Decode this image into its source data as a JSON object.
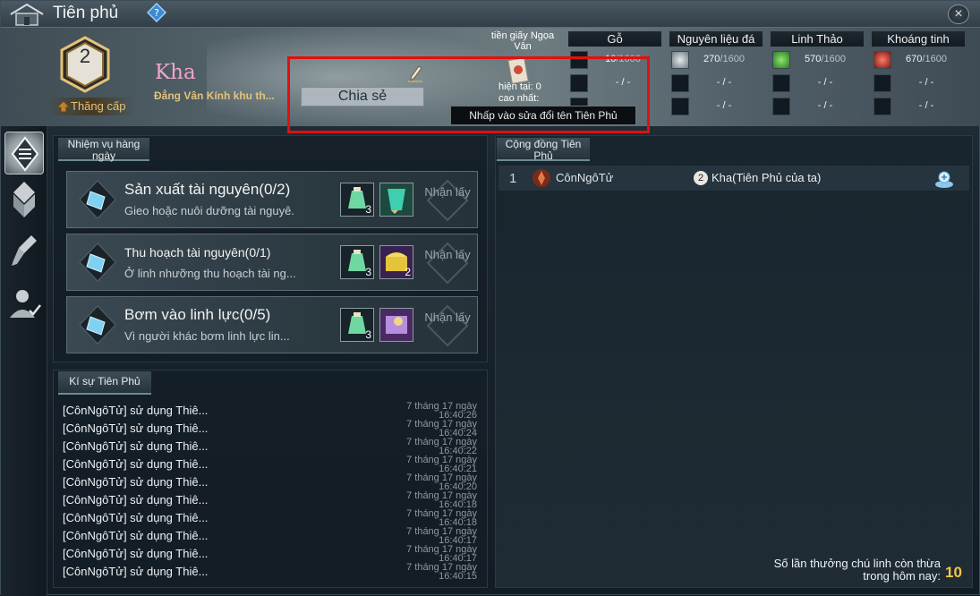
{
  "window": {
    "title": "Tiên phủ",
    "close_label": "×"
  },
  "header": {
    "level": "2",
    "levelup_label": "Thăng cấp",
    "owner_name": "Kha",
    "owner_desc": "Đẳng Vân Kính khu th...",
    "share_label": "Chia sẻ",
    "tooltip": "Nhấp vào sửa đổi tên Tiên Phủ"
  },
  "currency": {
    "label": "tiền giấy Ngọa Vân",
    "current": "hiện tại: 0",
    "max": "cao nhất:"
  },
  "resources": [
    {
      "name": "Gỗ",
      "rows": [
        {
          "value": "10",
          "max": "/1600"
        },
        {
          "value": "- / -",
          "max": ""
        },
        {
          "value": "",
          "max": ""
        }
      ]
    },
    {
      "name": "Nguyên liệu đá",
      "rows": [
        {
          "value": "270",
          "max": "/1600"
        },
        {
          "value": "- / -",
          "max": ""
        },
        {
          "value": "- / -",
          "max": ""
        }
      ]
    },
    {
      "name": "Linh Thảo",
      "rows": [
        {
          "value": "570",
          "max": "/1600"
        },
        {
          "value": "- / -",
          "max": ""
        },
        {
          "value": "- / -",
          "max": ""
        }
      ]
    },
    {
      "name": "Khoáng tinh",
      "rows": [
        {
          "value": "670",
          "max": "/1600"
        },
        {
          "value": "- / -",
          "max": ""
        },
        {
          "value": "- / -",
          "max": ""
        }
      ]
    }
  ],
  "resource_colors": [
    "#cfd4d6",
    "#d9dfe2",
    "#4fbf3c",
    "#c33a2f"
  ],
  "sidebar": {
    "items": [
      "list-icon",
      "building-icon",
      "shovel-icon",
      "character-icon"
    ]
  },
  "daily": {
    "tab": "Nhiệm vụ hàng ngày",
    "claim_label": "Nhận lấy",
    "tasks": [
      {
        "title": "Sản xuất tài nguyên",
        "progress": "(0/2)",
        "desc": "Gieo hoặc nuôi dưỡng tài nguyê.",
        "reward1_count": "3",
        "reward2_count": ""
      },
      {
        "title": "Thu hoạch tài nguyên",
        "progress": "(0/1)",
        "desc": "Ở linh nhưỡng thu hoạch tài ng...",
        "reward1_count": "3",
        "reward2_count": "2"
      },
      {
        "title": "Bơm vào linh lực",
        "progress": "(0/5)",
        "desc": "Vì người khác bơm linh lực lin...",
        "reward1_count": "3",
        "reward2_count": ""
      }
    ]
  },
  "log": {
    "tab": "Kí sự Tiên Phủ",
    "entries": [
      {
        "text": "[CônNgôTử] sử dụng Thiê...",
        "time": "7 tháng 17 ngày 16:40:26"
      },
      {
        "text": "[CônNgôTử] sử dụng Thiê...",
        "time": "7 tháng 17 ngày 16:40:24"
      },
      {
        "text": "[CônNgôTử] sử dụng Thiê...",
        "time": "7 tháng 17 ngày 16:40:22"
      },
      {
        "text": "[CônNgôTử] sử dụng Thiê...",
        "time": "7 tháng 17 ngày 16:40:21"
      },
      {
        "text": "[CônNgôTử] sử dụng Thiê...",
        "time": "7 tháng 17 ngày 16:40:20"
      },
      {
        "text": "[CônNgôTử] sử dụng Thiê...",
        "time": "7 tháng 17 ngày 16:40:18"
      },
      {
        "text": "[CônNgôTử] sử dụng Thiê...",
        "time": "7 tháng 17 ngày 16:40:18"
      },
      {
        "text": "[CônNgôTử] sử dụng Thiê...",
        "time": "7 tháng 17 ngày 16:40:17"
      },
      {
        "text": "[CônNgôTử] sử dụng Thiê...",
        "time": "7 tháng 17 ngày 16:40:17"
      },
      {
        "text": "[CônNgôTử] sử dụng Thiê...",
        "time": "7 tháng 17 ngày 16:40:15"
      }
    ]
  },
  "community": {
    "tab": "Cộng đồng Tiên Phủ",
    "rows": [
      {
        "rank": "1",
        "player": "CônNgôTử",
        "level": "2",
        "owner": "Kha(Tiên Phủ của ta)"
      }
    ]
  },
  "spirit": {
    "label": "Số lần thưởng chú linh còn thừa trong hôm nay:",
    "count": "10"
  }
}
